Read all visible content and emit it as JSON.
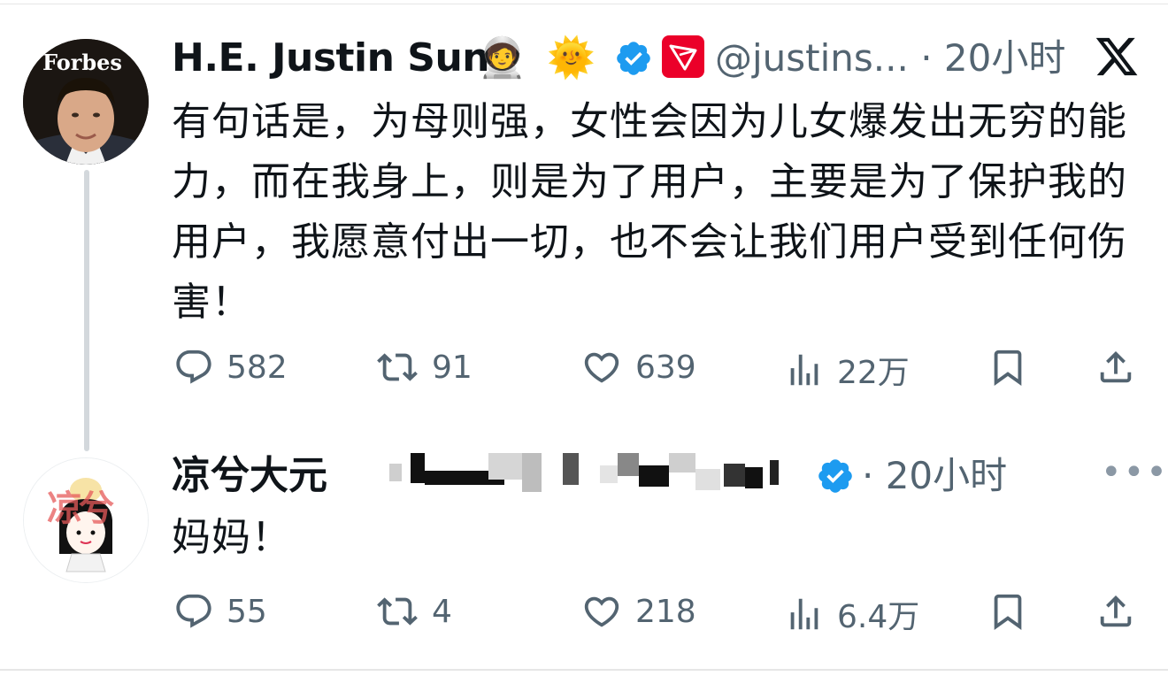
{
  "tweets": [
    {
      "author": "H.E. Justin Sun",
      "emojis": [
        "🧑‍🚀",
        "🌞"
      ],
      "handle": "@justins...",
      "time": "· 20小时",
      "text": "有句话是，为母则强，女性会因为儿女爆发出无穷的能力，而在我身上，则是为了用户，主要是为了保护我的用户，我愿意付出一切，也不会让我们用户受到任何伤害！",
      "avatar_label": "Forbes",
      "stats": {
        "replies": "582",
        "reposts": "91",
        "likes": "639",
        "views": "22万"
      }
    },
    {
      "author": "凉兮大元",
      "avatar_label": "凉兮",
      "time": "· 20小时",
      "text": "妈妈！",
      "stats": {
        "replies": "55",
        "reposts": "4",
        "likes": "218",
        "views": "6.4万"
      }
    }
  ],
  "colors": {
    "verified": "#1d9bf0",
    "tron": "#eb0029",
    "muted": "#536471"
  },
  "icons": [
    "reply-icon",
    "repost-icon",
    "like-icon",
    "views-icon",
    "bookmark-icon",
    "share-icon",
    "verified-icon",
    "tron-logo-icon",
    "x-logo-icon",
    "more-icon"
  ]
}
